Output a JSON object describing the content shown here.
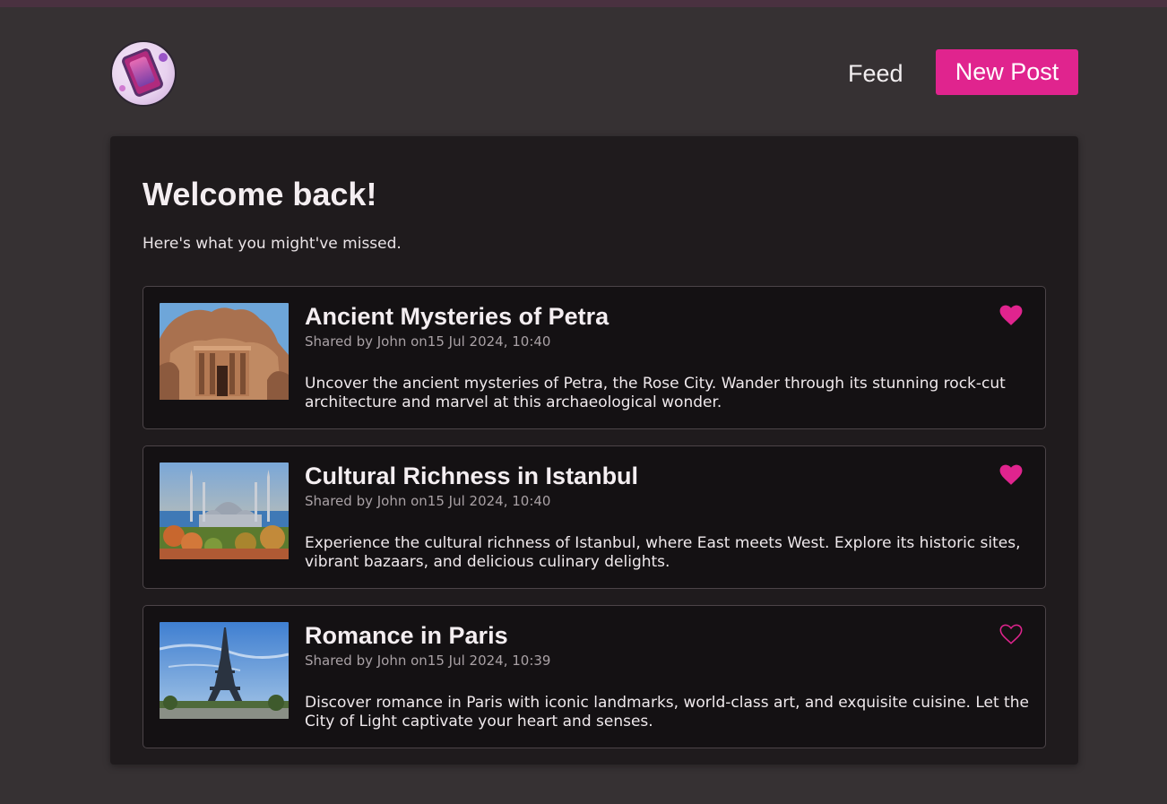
{
  "header": {
    "logo_icon": "phone-app-logo",
    "nav_feed": "Feed",
    "new_post": "New Post",
    "accent_color": "#e0248e"
  },
  "main": {
    "title": "Welcome back!",
    "subtitle": "Here's what you might've missed."
  },
  "posts": [
    {
      "title": "Ancient Mysteries of Petra",
      "meta": "Shared by John on15 Jul 2024, 10:40",
      "body": "Uncover the ancient mysteries of Petra, the Rose City. Wander through its stunning rock-cut architecture and marvel at this archaeological wonder.",
      "liked": true,
      "image": "petra-treasury-photo"
    },
    {
      "title": "Cultural Richness in Istanbul",
      "meta": "Shared by John on15 Jul 2024, 10:40",
      "body": "Experience the cultural richness of Istanbul, where East meets West. Explore its historic sites, vibrant bazaars, and delicious culinary delights.",
      "liked": true,
      "image": "istanbul-mosque-photo"
    },
    {
      "title": "Romance in Paris",
      "meta": "Shared by John on15 Jul 2024, 10:39",
      "body": "Discover romance in Paris with iconic landmarks, world-class art, and exquisite cuisine. Let the City of Light captivate your heart and senses.",
      "liked": false,
      "image": "eiffel-tower-photo"
    }
  ]
}
